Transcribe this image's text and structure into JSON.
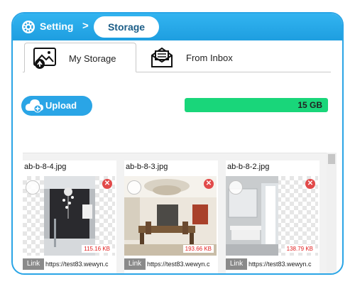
{
  "breadcrumb": {
    "parent": "Setting",
    "separator": ">",
    "current": "Storage"
  },
  "tabs": [
    {
      "label": "My Storage",
      "icon": "image-upload-icon",
      "active": true
    },
    {
      "label": "From Inbox",
      "icon": "envelope-icon",
      "active": false
    }
  ],
  "upload": {
    "label": "Upload",
    "icon": "cloud-upload-icon"
  },
  "quota": {
    "label": "15 GB",
    "fill_fraction": 1.0,
    "color": "#19d67a"
  },
  "files": [
    {
      "name": "ab-b-8-4.jpg",
      "size": "115.16 KB",
      "link_label": "Link",
      "url": "https://test83.wewyn.c"
    },
    {
      "name": "ab-b-8-3.jpg",
      "size": "193.66 KB",
      "link_label": "Link",
      "url": "https://test83.wewyn.c"
    },
    {
      "name": "ab-b-8-2.jpg",
      "size": "138.79 KB",
      "link_label": "Link",
      "url": "https://test83.wewyn.c"
    }
  ],
  "colors": {
    "accent": "#2aa5e6",
    "delete": "#e24a4a",
    "size_text": "#e02020"
  }
}
